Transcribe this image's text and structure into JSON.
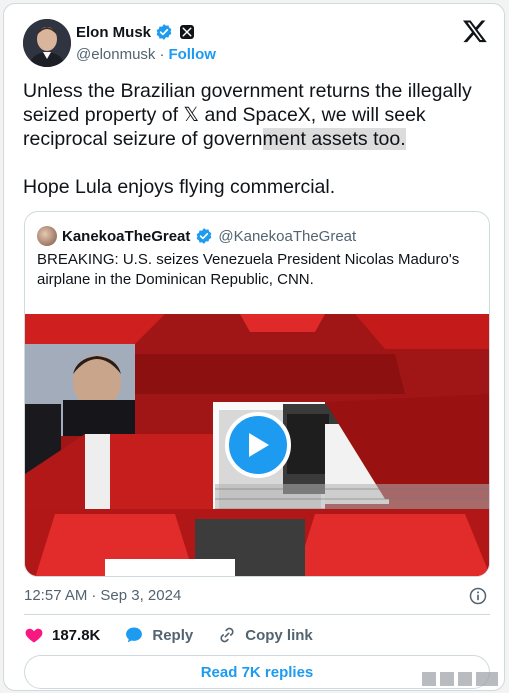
{
  "author": {
    "name": "Elon Musk",
    "handle": "@elonmusk",
    "follow_label": "Follow",
    "separator": "·"
  },
  "tweet": {
    "line1": "Unless the Brazilian government returns the illegally seized property of 𝕏 and SpaceX, we will seek reciprocal seizure of govern",
    "line1_highlight": "ment assets too.",
    "line2": "Hope Lula enjoys flying commercial."
  },
  "quote": {
    "name": "KanekoaTheGreat",
    "handle": "@KanekoaTheGreat",
    "text": "BREAKING: U.S. seizes Venezuela President Nicolas Maduro's airplane in the Dominican Republic, CNN."
  },
  "meta": {
    "time": "12:57 AM",
    "separator": "·",
    "date": "Sep 3, 2024"
  },
  "actions": {
    "likes": "187.8K",
    "reply_label": "Reply",
    "copy_label": "Copy link"
  },
  "replies_button": "Read 7K replies",
  "colors": {
    "accent": "#1d9bf0",
    "like": "#f91880",
    "text": "#0f1419",
    "muted": "#536471",
    "border": "#cfd9de",
    "video_red": "#9e1414"
  },
  "icons": [
    "verified-icon",
    "x-badge-icon",
    "x-logo-icon",
    "play-icon",
    "info-icon",
    "heart-icon",
    "reply-icon",
    "link-icon"
  ]
}
